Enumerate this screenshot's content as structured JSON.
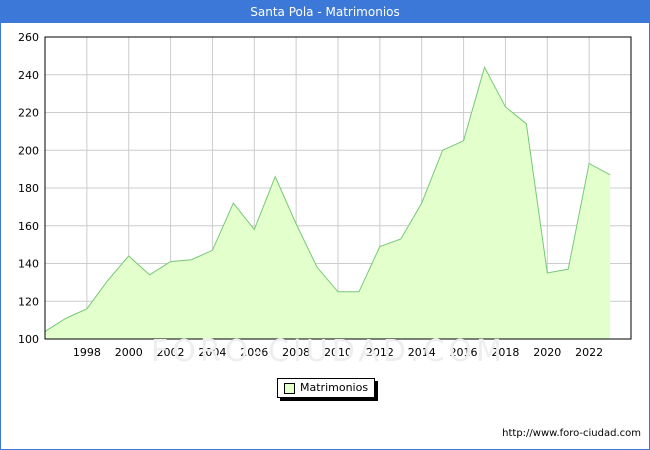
{
  "header": {
    "title": "Santa Pola - Matrimonios"
  },
  "watermark": "FORO-CIUDAD.COM",
  "footer": {
    "source": "http://www.foro-ciudad.com"
  },
  "colors": {
    "header_bg": "#3c78d8",
    "fill": "#e2ffcc",
    "line": "#78c878",
    "grid": "#cccccc"
  },
  "chart_data": {
    "type": "area",
    "title": "Santa Pola - Matrimonios",
    "xlabel": "",
    "ylabel": "",
    "xlim": [
      1996,
      2024
    ],
    "ylim": [
      100,
      260
    ],
    "x_ticks": [
      1998,
      2000,
      2002,
      2004,
      2006,
      2008,
      2010,
      2012,
      2014,
      2016,
      2018,
      2020,
      2022
    ],
    "y_ticks": [
      100,
      120,
      140,
      160,
      180,
      200,
      220,
      240,
      260
    ],
    "grid": true,
    "legend": "bottom-center",
    "series": [
      {
        "name": "Matrimonios",
        "x": [
          1996,
          1997,
          1998,
          1999,
          2000,
          2001,
          2002,
          2003,
          2004,
          2005,
          2006,
          2007,
          2008,
          2009,
          2010,
          2011,
          2012,
          2013,
          2014,
          2015,
          2016,
          2017,
          2018,
          2019,
          2020,
          2021,
          2022,
          2023
        ],
        "values": [
          104,
          111,
          116,
          131,
          144,
          134,
          141,
          142,
          147,
          172,
          158,
          186,
          161,
          138,
          125,
          125,
          149,
          153,
          172,
          200,
          205,
          244,
          223,
          214,
          135,
          137,
          193,
          187
        ]
      }
    ]
  }
}
